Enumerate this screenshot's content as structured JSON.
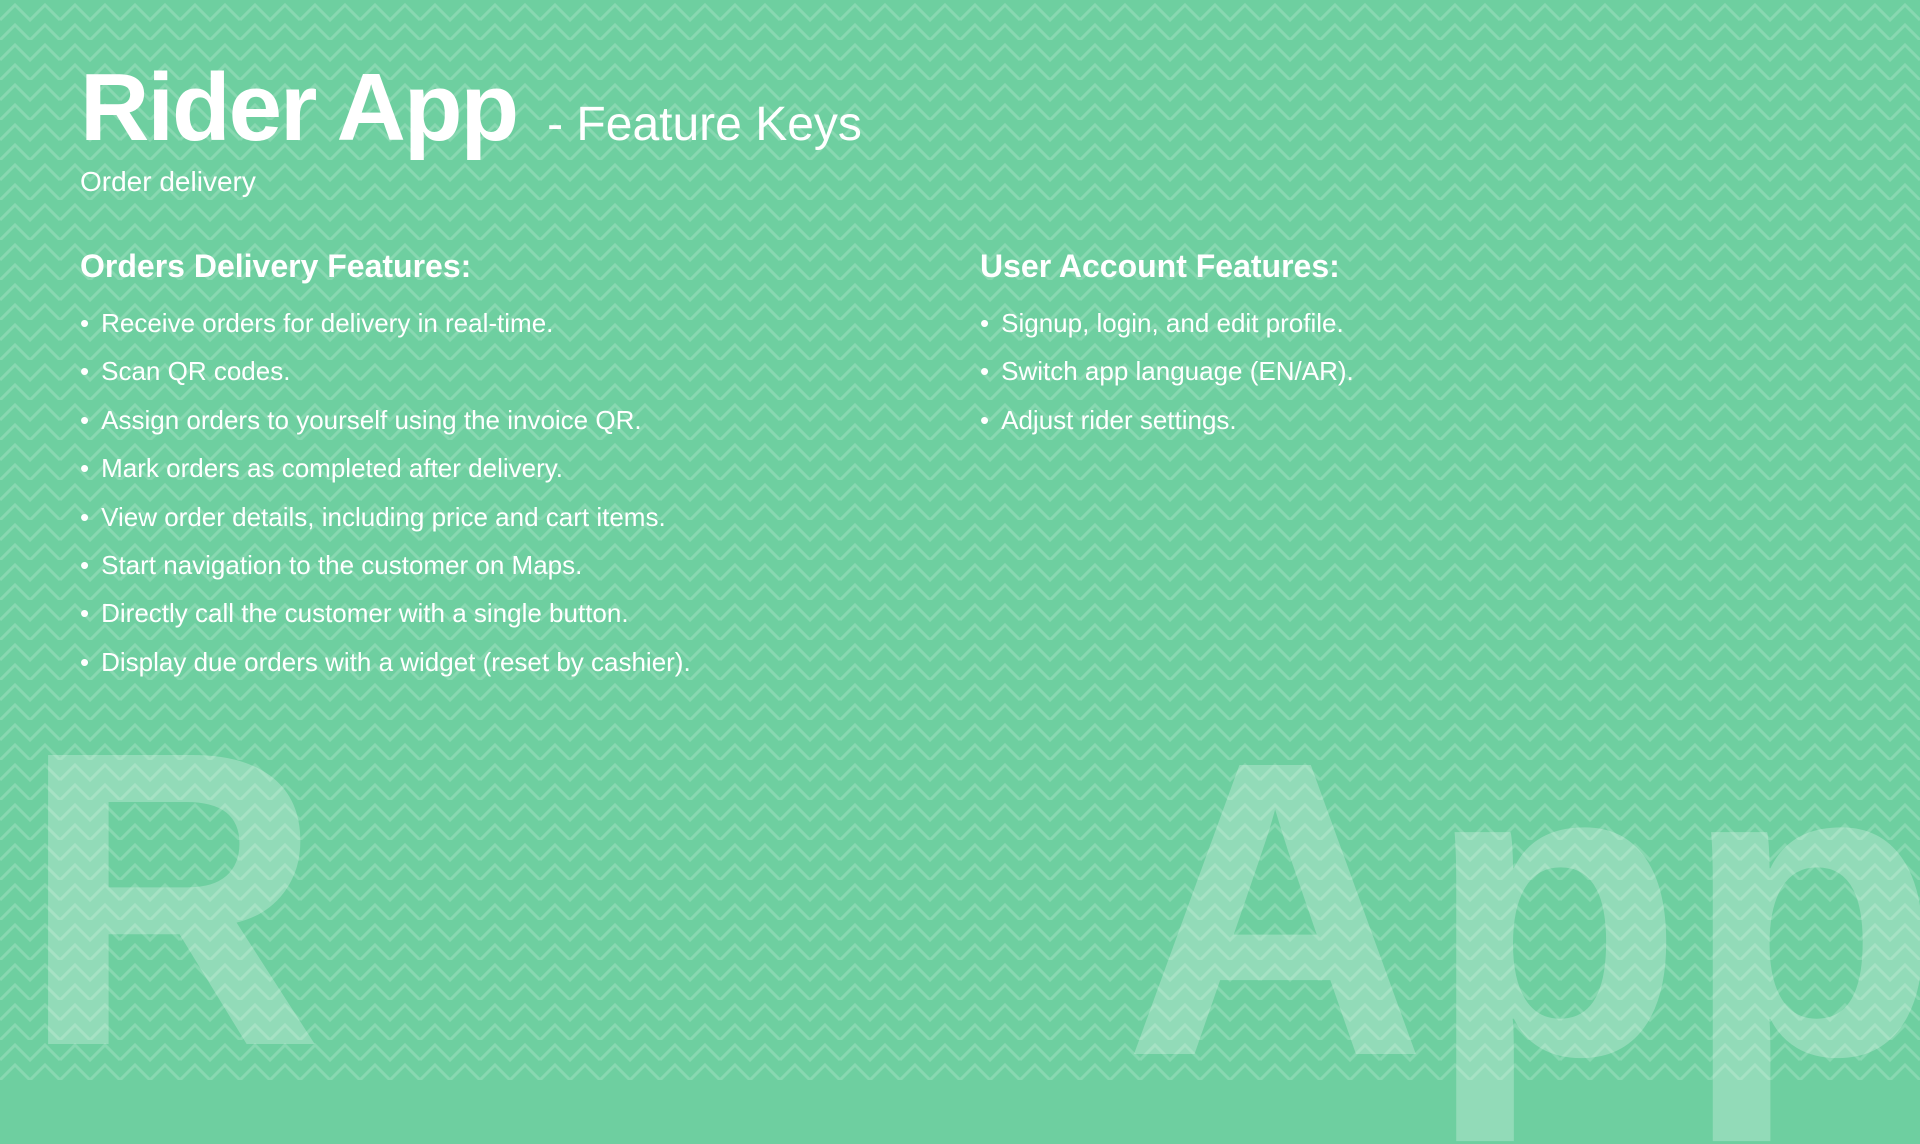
{
  "background": {
    "color": "#6ecfa0",
    "pattern_color": "rgba(255,255,255,0.15)"
  },
  "header": {
    "title_main": "Rider App",
    "title_sub": "- Feature Keys",
    "subtitle": "Order delivery"
  },
  "left_column": {
    "heading": "Orders Delivery Features:",
    "items": [
      "Receive orders for delivery in real-time.",
      "Scan QR codes.",
      "Assign orders to yourself using the invoice QR.",
      "Mark orders as completed after delivery.",
      "View order details, including price and cart items.",
      "Start navigation to the customer on Maps.",
      "Directly call the customer with a single button.",
      "Display due orders with a widget (reset by cashier)."
    ]
  },
  "right_column": {
    "heading": "User Account Features:",
    "items": [
      "Signup, login, and edit profile.",
      "Switch app language (EN/AR).",
      "Adjust rider settings."
    ]
  },
  "bg_letters": {
    "left": "R",
    "right": "App"
  }
}
